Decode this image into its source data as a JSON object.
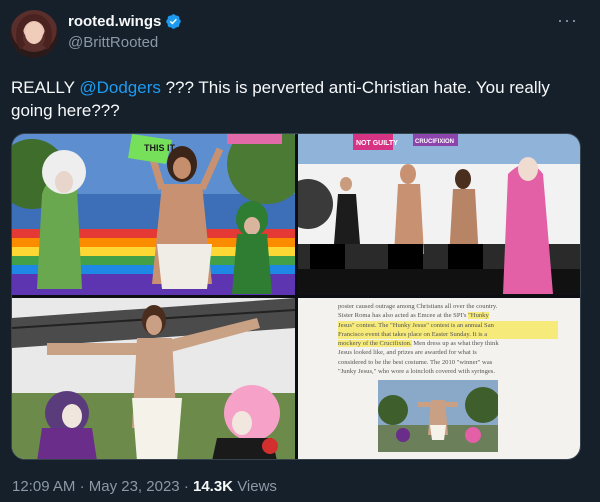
{
  "author": {
    "display_name": "rooted.wings",
    "handle": "@BrittRooted"
  },
  "tweet": {
    "text_prefix": "REALLY ",
    "mention": "@Dodgers",
    "text_suffix": " ??? This is perverted anti-Christian hate. You really going here???"
  },
  "images": {
    "top_left_sign": "THIS IT",
    "top_right_signs": [
      "NOT GUILTY",
      "CRUCIFIXION"
    ],
    "article_excerpt": {
      "line1": "poster caused outrage among Christians all over the country.",
      "line2a": "Sister Roma has also acted as Emcee at the SPI's ",
      "line2b": "\"Hunky",
      "line3a": "Jesus\" contest. The \"Hunky Jesus\" contest is an annual San",
      "line4a": "Francisco event that takes place on Easter Sunday. It is a",
      "line5a": "mockery of the Crucifixion.",
      "line5b": " Men dress up as what they think",
      "line6": "Jesus looked like, and prizes are awarded for what is",
      "line7": "considered to be the best costume. The 2010 \"winner\" was",
      "line8": "\"Junky Jesus,\" who wore a loincloth covered with syringes."
    }
  },
  "meta": {
    "time": "12:09 AM",
    "separator": "·",
    "date": "May 23, 2023",
    "views_count": "14.3K",
    "views_label": "Views"
  },
  "colors": {
    "background": "#15202b",
    "text": "#f7f9f9",
    "secondary": "#8b98a5",
    "accent": "#1d9bf0"
  }
}
